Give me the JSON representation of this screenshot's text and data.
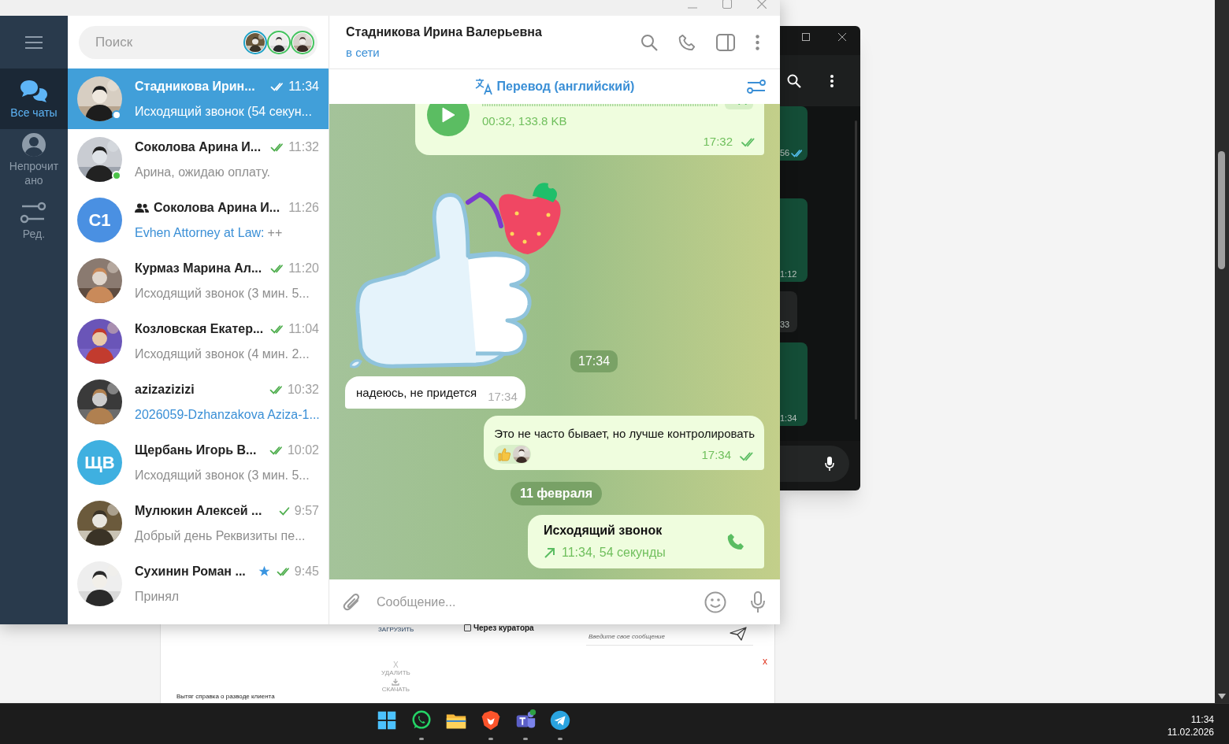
{
  "background_page": {
    "upload_label": "ЗАГРУЗИТЬ",
    "checkbox": {
      "label": "Через куратора",
      "checked": false
    },
    "message_placeholder": "Введите свое сообщение",
    "close_mark": "x",
    "delete_mark": "X",
    "delete_label": "УДАЛИТЬ",
    "download_label": "СКАЧАТЬ",
    "document_name": "Вытяг справка о разводе клиента"
  },
  "side_window": {
    "bubbles": [
      {
        "kind": "outgoing",
        "time": "56",
        "read": true
      },
      {
        "kind": "outgoing",
        "time": "1:12",
        "read": false
      },
      {
        "kind": "incoming",
        "time": "33",
        "read": false
      },
      {
        "kind": "outgoing",
        "time": "1:34",
        "read": false
      }
    ]
  },
  "rail": [
    {
      "label": "Все чаты",
      "selected": true
    },
    {
      "label": "Непрочитано",
      "selected": false
    },
    {
      "label": "Ред.",
      "selected": false
    }
  ],
  "search": {
    "placeholder": "Поиск"
  },
  "chats": [
    {
      "name": "Стадникова Ирин...",
      "time": "11:34",
      "preview": "Исходящий звонок (54 секун...",
      "link_preview": false,
      "sent": true,
      "read": true,
      "online": true,
      "group": false,
      "starred": false,
      "selected": true
    },
    {
      "name": "Соколова Арина И...",
      "time": "11:32",
      "preview": "Арина, ожидаю оплату.",
      "link_preview": false,
      "sent": true,
      "read": true,
      "online": true,
      "group": false,
      "starred": false,
      "selected": false
    },
    {
      "name": "Соколова Арина И...",
      "time": "11:26",
      "sender": "Evhen Attorney at Law:",
      "preview": "++",
      "link_preview": false,
      "sent": false,
      "online": false,
      "group": true,
      "starred": false,
      "selected": false,
      "avatar": {
        "kind": "initials",
        "initials": "С1",
        "color": "#4a90e2"
      }
    },
    {
      "name": "Курмаз Марина Ал...",
      "time": "11:20",
      "preview": "Исходящий звонок (3 мин. 5...",
      "link_preview": false,
      "sent": true,
      "read": true,
      "online": false,
      "group": false,
      "starred": false,
      "selected": false
    },
    {
      "name": "Козловская Екатер...",
      "time": "11:04",
      "preview": "Исходящий звонок (4 мин. 2...",
      "link_preview": false,
      "sent": true,
      "read": true,
      "online": false,
      "group": false,
      "starred": false,
      "selected": false
    },
    {
      "name": "azizazizizi",
      "time": "10:32",
      "preview": "2026059-Dzhanzakova Aziza-1...",
      "link_preview": true,
      "sent": true,
      "read": true,
      "online": false,
      "group": false,
      "starred": false,
      "selected": false
    },
    {
      "name": "Щербань Игорь В...",
      "time": "10:02",
      "preview": "Исходящий звонок (3 мин. 5...",
      "link_preview": false,
      "sent": true,
      "read": true,
      "online": false,
      "group": false,
      "starred": false,
      "selected": false,
      "avatar": {
        "kind": "initials",
        "initials": "ЩВ",
        "color": "#3fb0e0"
      }
    },
    {
      "name": "Мулюкин Алексей ...",
      "time": "9:57",
      "preview": "Добрый день Реквизиты пе...",
      "link_preview": false,
      "sent": true,
      "read": false,
      "online": false,
      "group": false,
      "starred": false,
      "selected": false
    },
    {
      "name": "Сухинин Роман ...",
      "time": "9:45",
      "preview": "Принял",
      "link_preview": false,
      "sent": true,
      "read": true,
      "online": false,
      "group": false,
      "starred": true,
      "selected": false
    }
  ],
  "chat": {
    "title": "Стадникова Ирина Валерьевна",
    "status": "в сети",
    "translate_bar": "Перевод (английский)",
    "messages": [
      {
        "kind": "voice",
        "info": "00:32, 133.8 KB",
        "time": "17:32",
        "read": true
      },
      {
        "kind": "sticker",
        "time": "17:34"
      },
      {
        "kind": "incoming",
        "text": "надеюсь, не придется",
        "time": "17:34"
      },
      {
        "kind": "outgoing",
        "text": "Это не часто бывает, но лучше контролировать",
        "time": "17:34",
        "read": true,
        "reaction": true
      },
      {
        "kind": "date",
        "text": "11 февраля"
      },
      {
        "kind": "call",
        "title": "Исходящий звонок",
        "detail": "11:34, 54 секунды"
      }
    ],
    "composer": {
      "placeholder": "Сообщение..."
    }
  },
  "taskbar": {
    "apps": [
      {
        "kind": "start",
        "running": false
      },
      {
        "kind": "whatsapp",
        "running": true
      },
      {
        "kind": "explorer",
        "running": false
      },
      {
        "kind": "brave",
        "running": true
      },
      {
        "kind": "teams",
        "running": true
      },
      {
        "kind": "telegram",
        "running": true
      }
    ],
    "time": "11:34",
    "date": "11.02.2026"
  }
}
